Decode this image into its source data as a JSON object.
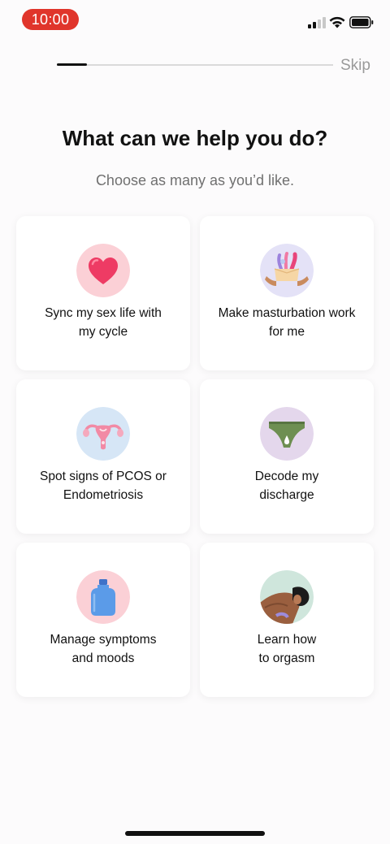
{
  "status": {
    "time": "10:00"
  },
  "header": {
    "skip_label": "Skip",
    "progress": 0.11
  },
  "title": "What can we help you do?",
  "subtitle": "Choose as many as you’d like.",
  "options": [
    {
      "line1": "Sync my sex life with",
      "line2": "my cycle",
      "icon": "heart-icon"
    },
    {
      "line1": "Make masturbation work",
      "line2": "for me",
      "icon": "toys-box-icon"
    },
    {
      "line1": "Spot signs of PCOS or",
      "line2": "Endometriosis",
      "icon": "uterus-icon"
    },
    {
      "line1": "Decode my",
      "line2": "discharge",
      "icon": "underwear-icon"
    },
    {
      "line1": "Manage symptoms",
      "line2": "and moods",
      "icon": "hot-water-bottle-icon"
    },
    {
      "line1": "Learn how",
      "line2": "to orgasm",
      "icon": "couple-icon"
    }
  ],
  "colors": {
    "time_pill": "#e0352b",
    "card": "#ffffff",
    "background": "#fcfbfc"
  }
}
